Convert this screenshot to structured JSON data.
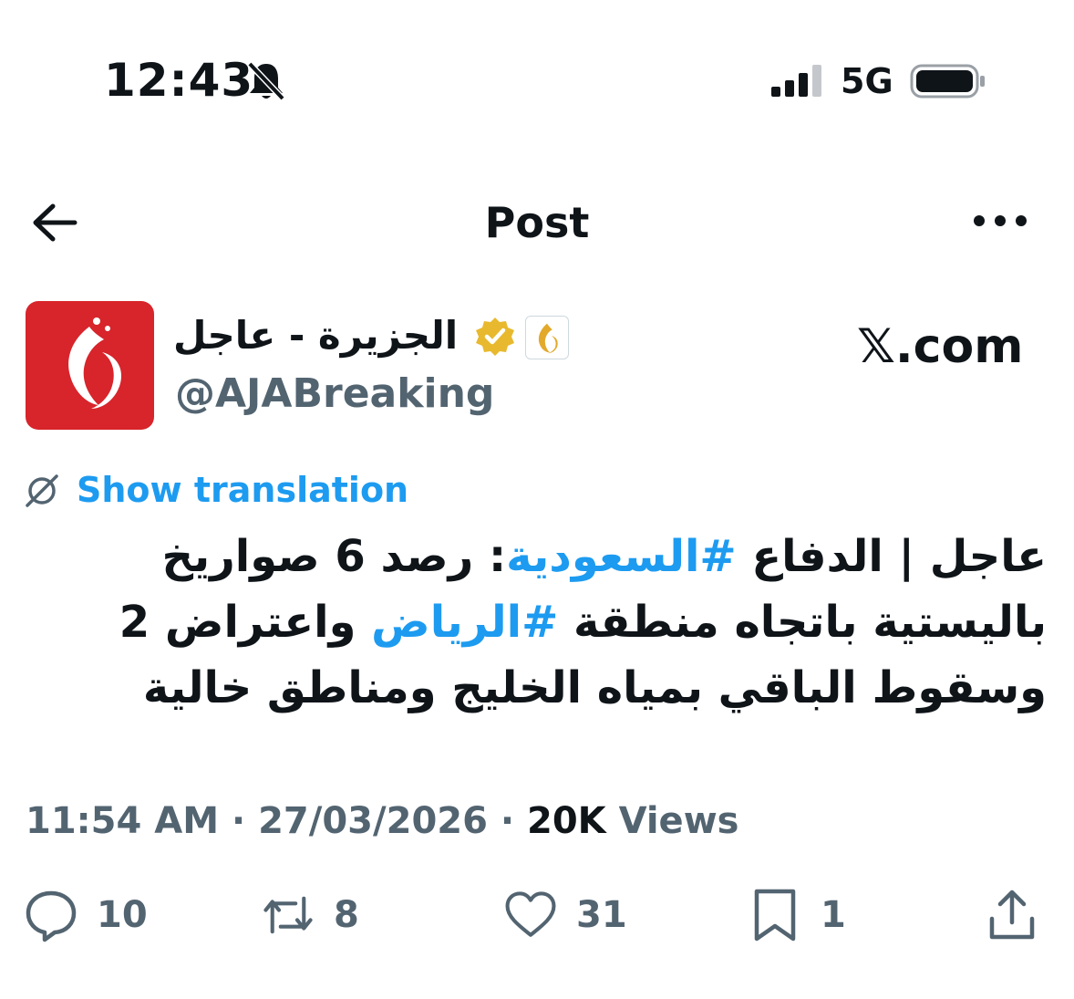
{
  "status_bar": {
    "time": "12:43",
    "network": "5G",
    "icons": [
      "bell-muted-icon",
      "signal-icon",
      "battery-icon"
    ]
  },
  "nav": {
    "title": "Post",
    "icons": [
      "back-arrow-icon",
      "more-icon"
    ]
  },
  "author": {
    "name": "الجزيرة - عاجل",
    "handle": "@AJABreaking",
    "verified_color": "#e8b92e",
    "avatar_color": "#d8242b"
  },
  "watermark": "𝕏.com",
  "translate": {
    "label": "Show translation"
  },
  "tweet": {
    "part1": "عاجل | الدفاع ",
    "tag1": "#السعودية",
    "part2": ": رصد 6 صواريخ باليستية باتجاه منطقة ",
    "tag2": "#الرياض",
    "part3": " واعتراض 2 وسقوط الباقي بمياه الخليج ومناطق خالية"
  },
  "meta": {
    "time": "11:54 AM",
    "date": "27/03/2026",
    "views_count": "20K",
    "views_label": "Views"
  },
  "actions": {
    "replies": "10",
    "reposts": "8",
    "likes": "31",
    "bookmarks": "1"
  },
  "colors": {
    "accent": "#1d9bf0",
    "muted": "#536471",
    "text": "#0f1419"
  }
}
